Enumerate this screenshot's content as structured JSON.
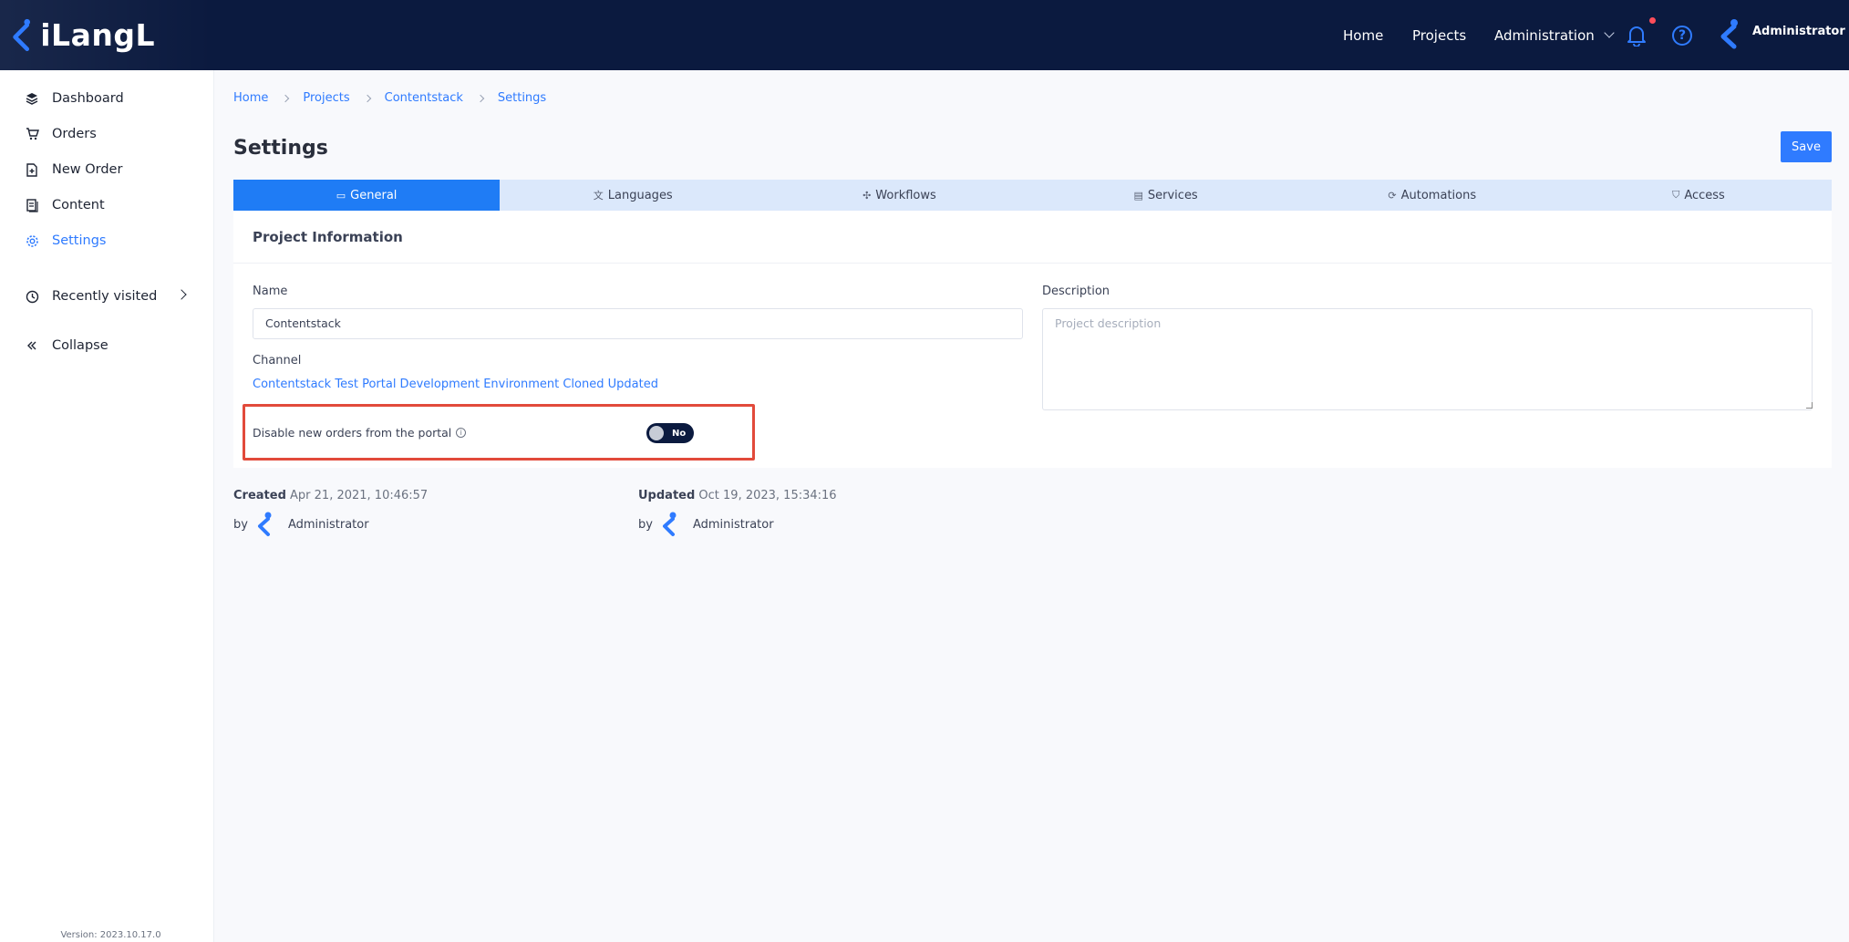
{
  "brand": {
    "name": "iLangL"
  },
  "topnav": {
    "home": "Home",
    "projects": "Projects",
    "administration": "Administration",
    "user": "Administrator"
  },
  "sidebar": {
    "items": [
      {
        "label": "Dashboard",
        "icon": "layers-icon"
      },
      {
        "label": "Orders",
        "icon": "cart-icon"
      },
      {
        "label": "New Order",
        "icon": "file-plus-icon"
      },
      {
        "label": "Content",
        "icon": "document-icon"
      },
      {
        "label": "Settings",
        "icon": "gear-icon",
        "active": true
      }
    ],
    "recently_visited": "Recently visited",
    "collapse": "Collapse",
    "version": "Version: 2023.10.17.0"
  },
  "breadcrumb": [
    "Home",
    "Projects",
    "Contentstack",
    "Settings"
  ],
  "page": {
    "title": "Settings",
    "save_label": "Save"
  },
  "tabs": [
    {
      "label": "General",
      "icon": "window-icon",
      "active": true
    },
    {
      "label": "Languages",
      "icon": "translate-icon"
    },
    {
      "label": "Workflows",
      "icon": "workflow-icon"
    },
    {
      "label": "Services",
      "icon": "server-icon"
    },
    {
      "label": "Automations",
      "icon": "sync-icon"
    },
    {
      "label": "Access",
      "icon": "shield-icon"
    }
  ],
  "project_info": {
    "title": "Project Information",
    "name_label": "Name",
    "name_value": "Contentstack",
    "description_label": "Description",
    "description_placeholder": "Project description",
    "channel_label": "Channel",
    "channel_value": "Contentstack Test Portal Development Environment Cloned Updated",
    "disable_orders_label": "Disable new orders from the portal",
    "disable_orders_value": "No"
  },
  "meta": {
    "created_label": "Created",
    "created_value": "Apr 21, 2021, 10:46:57",
    "created_by_prefix": "by",
    "created_by": "Administrator",
    "updated_label": "Updated",
    "updated_value": "Oct 19, 2023, 15:34:16",
    "updated_by_prefix": "by",
    "updated_by": "Administrator"
  },
  "colors": {
    "topbar": "#0b1a3f",
    "accent": "#2f7bff",
    "highlight": "#e24a3b",
    "notification": "#ff4d5a"
  }
}
